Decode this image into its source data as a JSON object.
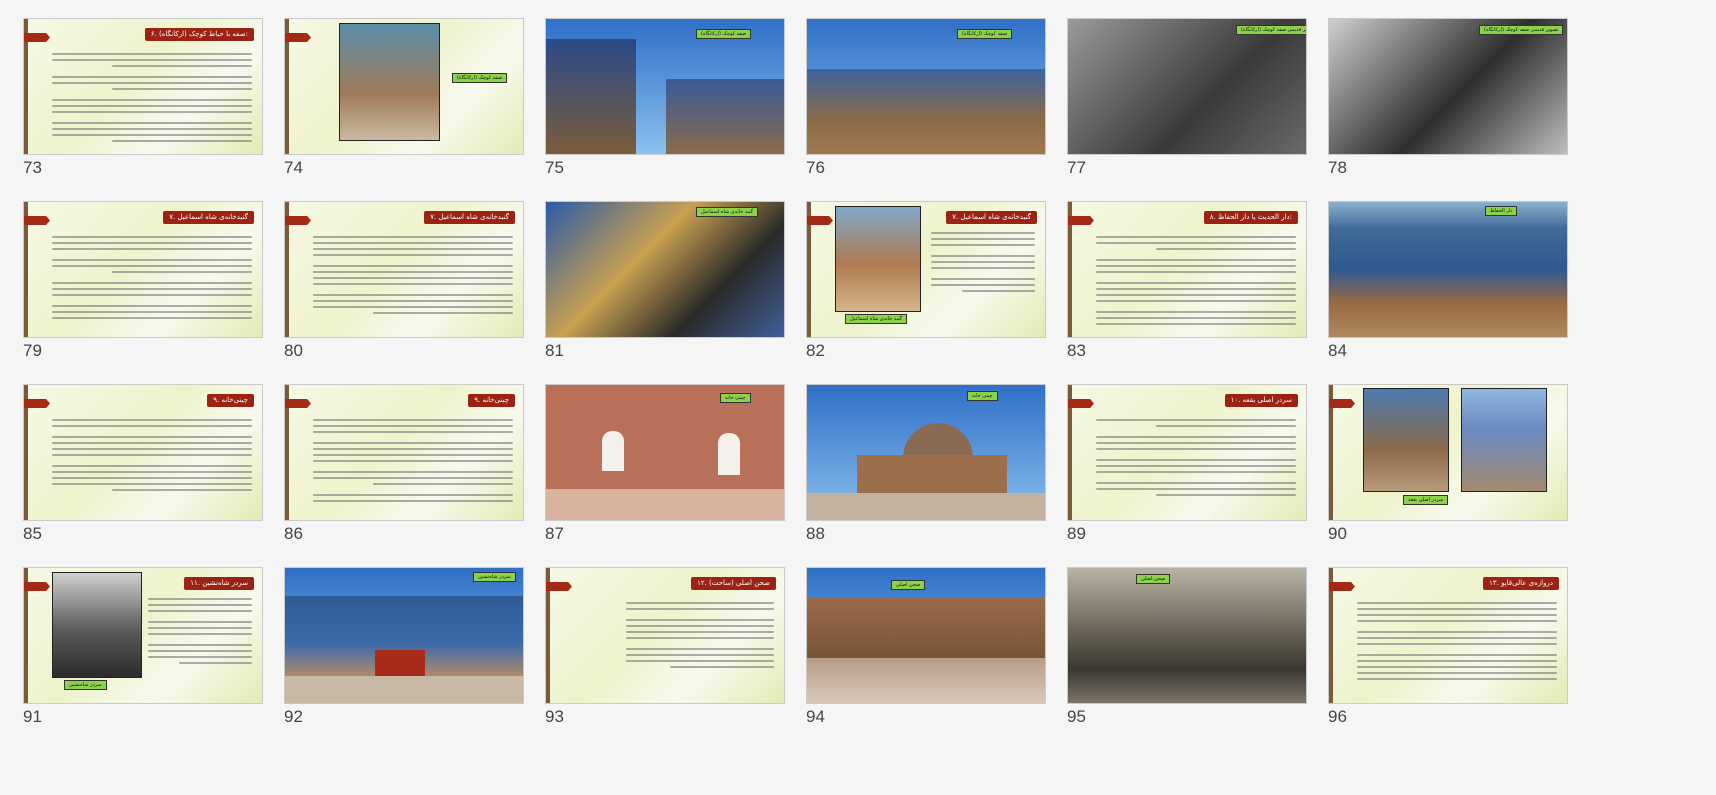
{
  "slides": [
    {
      "num": "73",
      "kind": "text",
      "title": "۶. صفه با حیاط کوچک (ارکانگاه):"
    },
    {
      "num": "74",
      "kind": "text-photo",
      "label": "صفه کوچک (ارکانگاه)"
    },
    {
      "num": "75",
      "kind": "photo",
      "label": "صفه کوچک (ارکانگاه)"
    },
    {
      "num": "76",
      "kind": "photo",
      "label": "صفه کوچک (ارکانگاه)"
    },
    {
      "num": "77",
      "kind": "photo-bw",
      "label": "تصویر قدیمی صفه کوچک (ارکانگاه)"
    },
    {
      "num": "78",
      "kind": "photo-bw",
      "label": "تصویر قدیمی صفه کوچک (ارکانگاه)"
    },
    {
      "num": "79",
      "kind": "text",
      "title": "۷. گنبدخانه‌ی شاه اسماعیل"
    },
    {
      "num": "80",
      "kind": "text",
      "title": "۷. گنبدخانه‌ی شاه اسماعیل"
    },
    {
      "num": "81",
      "kind": "photo",
      "label": "گنبد خانه‌ی شاه اسماعیل"
    },
    {
      "num": "82",
      "kind": "text-photo",
      "title": "۷. گنبدخانه‌ی شاه اسماعیل",
      "label": "گنبد خانه‌ی شاه اسماعیل"
    },
    {
      "num": "83",
      "kind": "text",
      "title": "۸. دار الحدیث یا دار الحفاظ:"
    },
    {
      "num": "84",
      "kind": "photo",
      "label": "دار الحفاظ"
    },
    {
      "num": "85",
      "kind": "text",
      "title": "۹. چینی‌خانه"
    },
    {
      "num": "86",
      "kind": "text",
      "title": "۹. چینی‌خانه"
    },
    {
      "num": "87",
      "kind": "photo",
      "label": "چینی خانه"
    },
    {
      "num": "88",
      "kind": "photo",
      "label": "چینی خانه"
    },
    {
      "num": "89",
      "kind": "text",
      "title": "۱۰. سردر اصلی بقعه"
    },
    {
      "num": "90",
      "kind": "photo-pair",
      "label": "سردر اصلی بقعه"
    },
    {
      "num": "91",
      "kind": "text-photo",
      "title": "۱۱. سردر شاه‌نشین",
      "label": "سردر شاه‌نشین"
    },
    {
      "num": "92",
      "kind": "photo",
      "label": "سردر شاه‌نشین"
    },
    {
      "num": "93",
      "kind": "text",
      "title": "۱۲. صحن اصلی (ساحت)"
    },
    {
      "num": "94",
      "kind": "photo",
      "label": "صحن اصلی"
    },
    {
      "num": "95",
      "kind": "photo-bw",
      "label": "صحن اصلی"
    },
    {
      "num": "96",
      "kind": "text",
      "title": "۱۳. دروازه‌ی عالی‌قاپو"
    }
  ]
}
